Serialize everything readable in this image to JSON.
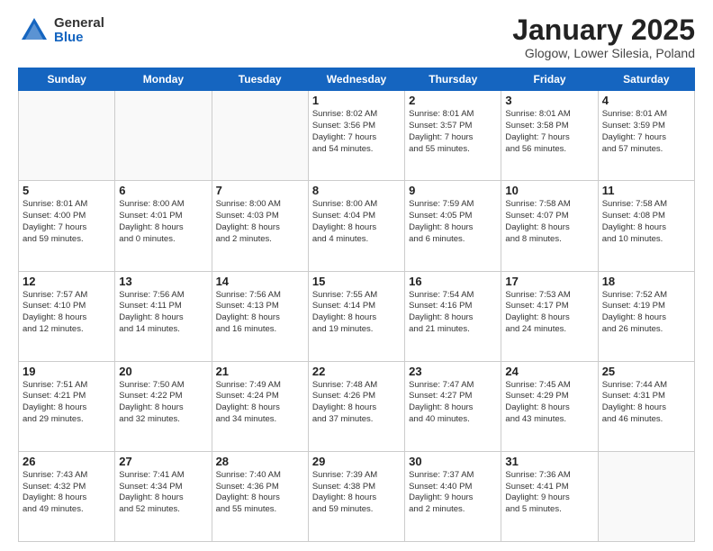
{
  "logo": {
    "general": "General",
    "blue": "Blue"
  },
  "title": {
    "month": "January 2025",
    "location": "Glogow, Lower Silesia, Poland"
  },
  "days_header": [
    "Sunday",
    "Monday",
    "Tuesday",
    "Wednesday",
    "Thursday",
    "Friday",
    "Saturday"
  ],
  "weeks": [
    [
      {
        "day": "",
        "info": ""
      },
      {
        "day": "",
        "info": ""
      },
      {
        "day": "",
        "info": ""
      },
      {
        "day": "1",
        "info": "Sunrise: 8:02 AM\nSunset: 3:56 PM\nDaylight: 7 hours\nand 54 minutes."
      },
      {
        "day": "2",
        "info": "Sunrise: 8:01 AM\nSunset: 3:57 PM\nDaylight: 7 hours\nand 55 minutes."
      },
      {
        "day": "3",
        "info": "Sunrise: 8:01 AM\nSunset: 3:58 PM\nDaylight: 7 hours\nand 56 minutes."
      },
      {
        "day": "4",
        "info": "Sunrise: 8:01 AM\nSunset: 3:59 PM\nDaylight: 7 hours\nand 57 minutes."
      }
    ],
    [
      {
        "day": "5",
        "info": "Sunrise: 8:01 AM\nSunset: 4:00 PM\nDaylight: 7 hours\nand 59 minutes."
      },
      {
        "day": "6",
        "info": "Sunrise: 8:00 AM\nSunset: 4:01 PM\nDaylight: 8 hours\nand 0 minutes."
      },
      {
        "day": "7",
        "info": "Sunrise: 8:00 AM\nSunset: 4:03 PM\nDaylight: 8 hours\nand 2 minutes."
      },
      {
        "day": "8",
        "info": "Sunrise: 8:00 AM\nSunset: 4:04 PM\nDaylight: 8 hours\nand 4 minutes."
      },
      {
        "day": "9",
        "info": "Sunrise: 7:59 AM\nSunset: 4:05 PM\nDaylight: 8 hours\nand 6 minutes."
      },
      {
        "day": "10",
        "info": "Sunrise: 7:58 AM\nSunset: 4:07 PM\nDaylight: 8 hours\nand 8 minutes."
      },
      {
        "day": "11",
        "info": "Sunrise: 7:58 AM\nSunset: 4:08 PM\nDaylight: 8 hours\nand 10 minutes."
      }
    ],
    [
      {
        "day": "12",
        "info": "Sunrise: 7:57 AM\nSunset: 4:10 PM\nDaylight: 8 hours\nand 12 minutes."
      },
      {
        "day": "13",
        "info": "Sunrise: 7:56 AM\nSunset: 4:11 PM\nDaylight: 8 hours\nand 14 minutes."
      },
      {
        "day": "14",
        "info": "Sunrise: 7:56 AM\nSunset: 4:13 PM\nDaylight: 8 hours\nand 16 minutes."
      },
      {
        "day": "15",
        "info": "Sunrise: 7:55 AM\nSunset: 4:14 PM\nDaylight: 8 hours\nand 19 minutes."
      },
      {
        "day": "16",
        "info": "Sunrise: 7:54 AM\nSunset: 4:16 PM\nDaylight: 8 hours\nand 21 minutes."
      },
      {
        "day": "17",
        "info": "Sunrise: 7:53 AM\nSunset: 4:17 PM\nDaylight: 8 hours\nand 24 minutes."
      },
      {
        "day": "18",
        "info": "Sunrise: 7:52 AM\nSunset: 4:19 PM\nDaylight: 8 hours\nand 26 minutes."
      }
    ],
    [
      {
        "day": "19",
        "info": "Sunrise: 7:51 AM\nSunset: 4:21 PM\nDaylight: 8 hours\nand 29 minutes."
      },
      {
        "day": "20",
        "info": "Sunrise: 7:50 AM\nSunset: 4:22 PM\nDaylight: 8 hours\nand 32 minutes."
      },
      {
        "day": "21",
        "info": "Sunrise: 7:49 AM\nSunset: 4:24 PM\nDaylight: 8 hours\nand 34 minutes."
      },
      {
        "day": "22",
        "info": "Sunrise: 7:48 AM\nSunset: 4:26 PM\nDaylight: 8 hours\nand 37 minutes."
      },
      {
        "day": "23",
        "info": "Sunrise: 7:47 AM\nSunset: 4:27 PM\nDaylight: 8 hours\nand 40 minutes."
      },
      {
        "day": "24",
        "info": "Sunrise: 7:45 AM\nSunset: 4:29 PM\nDaylight: 8 hours\nand 43 minutes."
      },
      {
        "day": "25",
        "info": "Sunrise: 7:44 AM\nSunset: 4:31 PM\nDaylight: 8 hours\nand 46 minutes."
      }
    ],
    [
      {
        "day": "26",
        "info": "Sunrise: 7:43 AM\nSunset: 4:32 PM\nDaylight: 8 hours\nand 49 minutes."
      },
      {
        "day": "27",
        "info": "Sunrise: 7:41 AM\nSunset: 4:34 PM\nDaylight: 8 hours\nand 52 minutes."
      },
      {
        "day": "28",
        "info": "Sunrise: 7:40 AM\nSunset: 4:36 PM\nDaylight: 8 hours\nand 55 minutes."
      },
      {
        "day": "29",
        "info": "Sunrise: 7:39 AM\nSunset: 4:38 PM\nDaylight: 8 hours\nand 59 minutes."
      },
      {
        "day": "30",
        "info": "Sunrise: 7:37 AM\nSunset: 4:40 PM\nDaylight: 9 hours\nand 2 minutes."
      },
      {
        "day": "31",
        "info": "Sunrise: 7:36 AM\nSunset: 4:41 PM\nDaylight: 9 hours\nand 5 minutes."
      },
      {
        "day": "",
        "info": ""
      }
    ]
  ]
}
